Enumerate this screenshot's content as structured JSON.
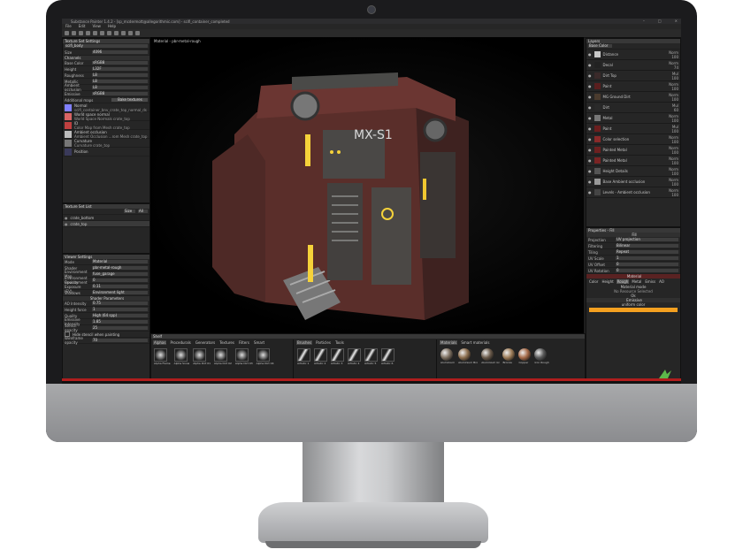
{
  "window": {
    "title": "Substance Painter 1.4.2 - [sp_mcdermott@allegorithmic.com] - scifi_container_completed",
    "buttons": [
      "–",
      "□",
      "×"
    ]
  },
  "menu": [
    "File",
    "Edit",
    "View",
    "Help"
  ],
  "texture_settings": {
    "title": "Texture Set Settings",
    "texture_set": "scifi_body",
    "size": "4096",
    "channels": [
      {
        "label": "Base Color",
        "value": "sRGB8"
      },
      {
        "label": "Height",
        "value": "L32F"
      },
      {
        "label": "Roughness",
        "value": "L8"
      },
      {
        "label": "Metallic",
        "value": "L8"
      },
      {
        "label": "Ambient occlusion",
        "value": "L8"
      },
      {
        "label": "Emissive",
        "value": "sRGB8"
      }
    ],
    "additional_maps": "Additional maps",
    "bake_label": "Bake textures",
    "maps": [
      {
        "name": "Normal",
        "file": "scifi_container_bnv_crate_top_normal_ds",
        "color": "#8080ff"
      },
      {
        "name": "World space normal",
        "file": "World Space Normals crate_top",
        "color": "#d86464"
      },
      {
        "name": "ID",
        "file": "Color Map from Mesh crate_top",
        "color": "#c04040"
      },
      {
        "name": "Ambient occlusion",
        "file": "Ambient Occlusion ...rom Mesh crate_top",
        "color": "#bcbcbc"
      },
      {
        "name": "Curvature",
        "file": "Curvature crate_top",
        "color": "#777777"
      },
      {
        "name": "Position",
        "file": "",
        "color": "#3a3a5a"
      }
    ]
  },
  "texture_list": {
    "title": "Texture Set List",
    "size_btn": "Size",
    "all_btn": "All",
    "items": [
      "crate_bottom",
      "crate_top"
    ]
  },
  "viewer": {
    "title": "Viewer Settings",
    "mode_label": "Mode",
    "mode": "Material",
    "rows": [
      {
        "label": "Shader",
        "value": "pbr-metal-rough"
      },
      {
        "label": "Environment Map",
        "value": "fuse_garage"
      },
      {
        "label": "Environment Opacity",
        "value": "0"
      },
      {
        "label": "Environment Exposure (EV)",
        "value": "0.11"
      },
      {
        "label": "Shadows",
        "value": "Environment light"
      }
    ],
    "shader_params": "Shader Parameters",
    "shader_rows": [
      {
        "label": "AO Intensity",
        "value": "0.75"
      },
      {
        "label": "Height force",
        "value": "1"
      },
      {
        "label": "Quality",
        "value": "High (64 spp)"
      },
      {
        "label": "Emissive Intensity",
        "value": "1.85"
      }
    ],
    "stencil_opacity_label": "Stencil opacity",
    "stencil_opacity": "25",
    "hide_stencil": "Hide stencil when painting",
    "wireframe_label": "Wireframe opacity",
    "wireframe": "70",
    "bottom_tabs": [
      "Viewer Settings",
      "Post Effects"
    ]
  },
  "viewport": {
    "label": "Material - pbr-metal-rough",
    "decal": "MX-S1"
  },
  "shelf": {
    "title": "Shelf",
    "tabs": [
      "Alphas",
      "Procedurals",
      "Generators",
      "Textures",
      "Filters",
      "Smart"
    ],
    "search": "Search",
    "alpha_names": [
      "Alpha Flame",
      "Alpha Snow",
      "Alpha Dirt 01",
      "Alpha Dirt 02",
      "Alpha Dirt 03",
      "Alpha Dirt 04"
    ],
    "brush_tabs": [
      "Brushes",
      "Particles",
      "Tools"
    ],
    "brush_names": [
      "Artistic 1",
      "Artistic 2",
      "Artistic 3",
      "Artistic 4",
      "Artistic 5",
      "Artistic 6"
    ],
    "material_tabs": [
      "Materials",
      "Smart materials"
    ],
    "material_names": [
      "Aluminium",
      "Aluminium Bro",
      "Aluminium Gl",
      "Bronze",
      "Copper",
      "Iron Rough"
    ],
    "material_colors": [
      "#7d6f60",
      "#8c6e4e",
      "#6a5a4a",
      "#9c7b57",
      "#a56a48",
      "#5a5a5a"
    ]
  },
  "layers": {
    "title": "Layers",
    "channel": "Base Color",
    "items": [
      {
        "name": "Distance",
        "blend": "Norm",
        "opacity": "100",
        "icon": "#c8c8c8"
      },
      {
        "name": "Decal",
        "blend": "Norm",
        "opacity": "74",
        "icon": "#222222"
      },
      {
        "name": "Dirt Top",
        "blend": "Mul",
        "opacity": "100",
        "icon": "#3a2a2a"
      },
      {
        "name": "Paint",
        "blend": "Norm",
        "opacity": "100",
        "icon": "#5a1e1e"
      },
      {
        "name": "MG Ground Dirt",
        "blend": "Norm",
        "opacity": "100",
        "icon": "#4a3b2e"
      },
      {
        "name": "Dirt",
        "blend": "Mul",
        "opacity": "60",
        "icon": "#2a2a2a"
      },
      {
        "name": "Metal",
        "blend": "Norm",
        "opacity": "100",
        "icon": "#777777"
      },
      {
        "name": "Paint",
        "blend": "Mul",
        "opacity": "100",
        "icon": "#6b1e1e"
      },
      {
        "name": "Color selection",
        "blend": "Norm",
        "opacity": "100",
        "icon": "#8a2a2a"
      },
      {
        "name": "Painted Metal",
        "blend": "Norm",
        "opacity": "100",
        "icon": "#6d2020"
      },
      {
        "name": "Painted Metal",
        "blend": "Norm",
        "opacity": "100",
        "icon": "#7a2424"
      },
      {
        "name": "Height Details",
        "blend": "Norm",
        "opacity": "100",
        "icon": "#555555"
      },
      {
        "name": "Base Ambient occlusion",
        "blend": "Norm",
        "opacity": "100",
        "icon": "#999999"
      },
      {
        "name": "Levels - Ambient occlusion",
        "blend": "Norm",
        "opacity": "100",
        "icon": "#444444"
      }
    ]
  },
  "properties": {
    "title": "Properties - Fill",
    "fill": "Fill",
    "rows": [
      {
        "label": "Projection",
        "value": "UV projection"
      },
      {
        "label": "Filtering",
        "value": "Bilinear"
      },
      {
        "label": "Tiling",
        "value": "Repeat"
      },
      {
        "label": "UV Scale",
        "value": "1"
      },
      {
        "label": "UV Offset",
        "value": "0"
      },
      {
        "label": "UV Rotation",
        "value": "0"
      }
    ],
    "material_header": "Material",
    "mat_tabs": [
      "Color",
      "Height",
      "Rough",
      "Metal",
      "Emiss",
      "AO"
    ],
    "material_mode": "Material mode",
    "no_resource": "No Resource Selected",
    "ok": "Ok",
    "emissive_header": "Emissive",
    "uniform": "uniform color",
    "emissive_color": "#f4a020"
  }
}
